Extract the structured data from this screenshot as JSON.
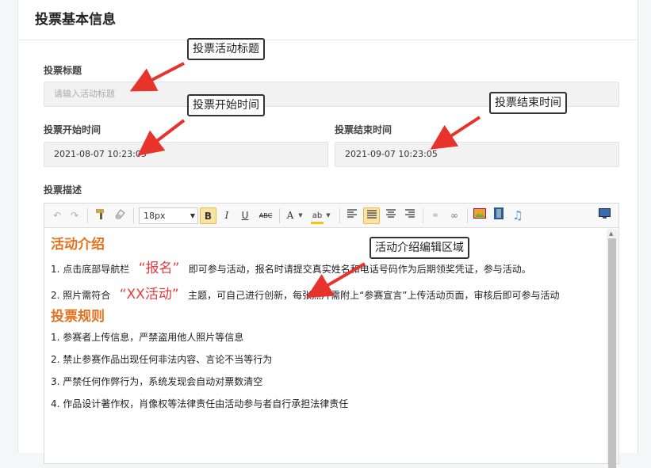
{
  "panel": {
    "title": "投票基本信息"
  },
  "form": {
    "title_label": "投票标题",
    "title_placeholder": "请输入活动标题",
    "start_label": "投票开始时间",
    "start_value": "2021-08-07 10:23:05",
    "end_label": "投票结束时间",
    "end_value": "2021-09-07 10:23:05",
    "desc_label": "投票描述"
  },
  "callouts": {
    "title": "投票活动标题",
    "start": "投票开始时间",
    "end": "投票结束时间",
    "editor": "活动介绍编辑区域"
  },
  "toolbar": {
    "font_size": "18px",
    "bold": "B",
    "italic": "I",
    "underline": "U",
    "strike": "ABC",
    "font_color": "A",
    "highlight": "ab"
  },
  "content": {
    "heading1": "活动介绍",
    "p1_prefix": "1. 点击底部导航栏",
    "p1_highlight": "“报名”",
    "p1_suffix": "即可参与活动，报名时请提交真实姓名和电话号码作为后期领奖凭证，参与活动。",
    "p2_prefix": "2. 照片需符合",
    "p2_highlight": "“XX活动”",
    "p2_suffix": "主题，可自己进行创新，每张照片需附上“参赛宣言”上传活动页面，审核后即可参与活动",
    "heading2": "投票规则",
    "rules": [
      "1. 参赛者上传信息，严禁盗用他人照片等信息",
      "2. 禁止参赛作品出现任何非法内容、言论不当等行为",
      "3. 严禁任何作弊行为，系统发现会自动对票数清空",
      "4. 作品设计著作权，肖像权等法律责任由活动参与者自行承担法律责任"
    ]
  },
  "colors": {
    "accent_orange": "#e5711f",
    "highlight_red": "#e83b3b",
    "arrow_red": "#e8322c"
  }
}
